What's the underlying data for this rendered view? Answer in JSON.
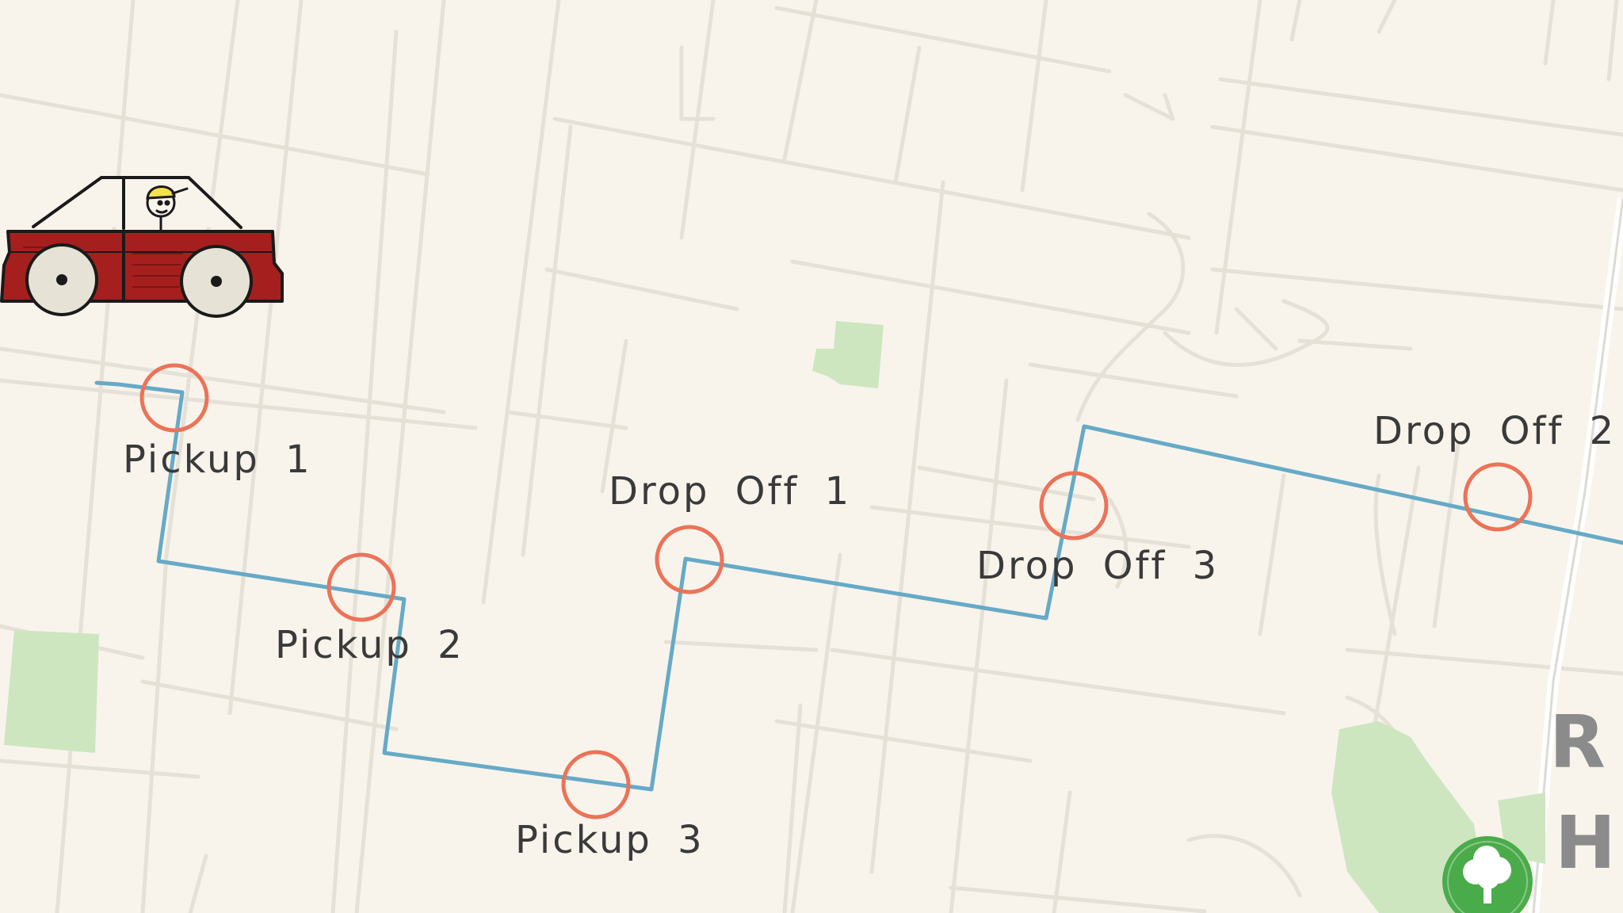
{
  "map": {
    "background_color": "#f8f4ec",
    "street_color": "#e6e1d7",
    "park_color": "#b6e0a8",
    "route_color": "#66aac7",
    "stop_marker_color": "#ec7358"
  },
  "vehicle": {
    "type": "car",
    "body_color": "#a51f1f",
    "driver_cap_color": "#f4e04d"
  },
  "stops": [
    {
      "label": "Pickup 1"
    },
    {
      "label": "Pickup 2"
    },
    {
      "label": "Pickup 3"
    },
    {
      "label": "Drop Off 1"
    },
    {
      "label": "Drop Off 2"
    },
    {
      "label": "Drop Off 3"
    }
  ],
  "road_label_partial": {
    "letters": [
      "R",
      "H"
    ]
  },
  "poi": {
    "icon": "tree-icon",
    "color": "#4aab4a"
  }
}
